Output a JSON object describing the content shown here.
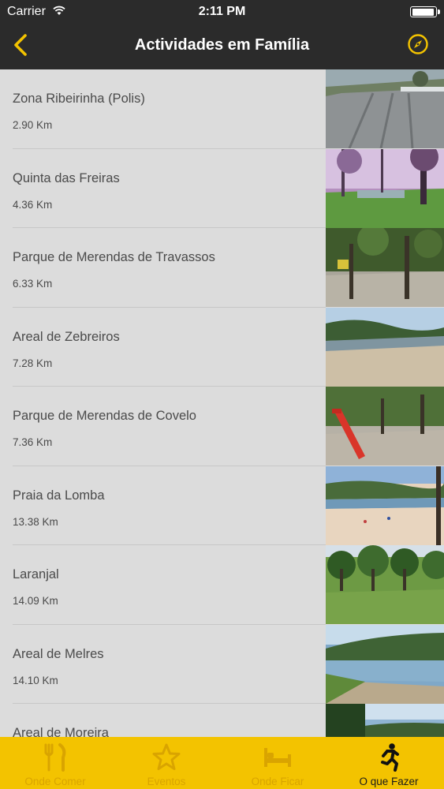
{
  "status_bar": {
    "carrier": "Carrier",
    "time": "2:11 PM"
  },
  "nav": {
    "title": "Actividades em Família",
    "accent_color": "#f3c300"
  },
  "list": [
    {
      "name": "Zona Ribeirinha (Polis)",
      "distance": "2.90 Km"
    },
    {
      "name": "Quinta das Freiras",
      "distance": "4.36 Km"
    },
    {
      "name": "Parque de Merendas de Travassos",
      "distance": "6.33 Km"
    },
    {
      "name": "Areal de Zebreiros",
      "distance": "7.28 Km"
    },
    {
      "name": "Parque de Merendas de Covelo",
      "distance": "7.36 Km"
    },
    {
      "name": "Praia da Lomba",
      "distance": "13.38 Km"
    },
    {
      "name": "Laranjal",
      "distance": "14.09 Km"
    },
    {
      "name": "Areal de Melres",
      "distance": "14.10 Km"
    },
    {
      "name": "Areal de Moreira",
      "distance": ""
    }
  ],
  "tabbar": {
    "tabs": [
      {
        "label": "Onde Comer",
        "icon": "fork-knife-icon"
      },
      {
        "label": "Eventos",
        "icon": "star-icon"
      },
      {
        "label": "Onde Ficar",
        "icon": "bed-icon"
      },
      {
        "label": "O que Fazer",
        "icon": "running-man-icon",
        "active": true
      }
    ]
  }
}
